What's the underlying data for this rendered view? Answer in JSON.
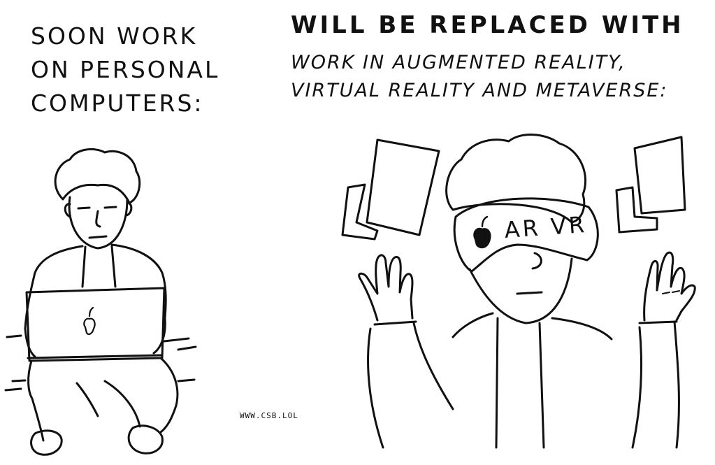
{
  "captions": {
    "left_lines": [
      "SOON WORK",
      "ON PERSONAL",
      "COMPUTERS:"
    ],
    "right_line_1": "WILL BE REPLACED WITH",
    "right_lines_2": [
      "WORK IN AUGMENTED REALITY,",
      "VIRTUAL REALITY AND METAVERSE:"
    ]
  },
  "headset_label": "AR VR",
  "watermark": "WWW.CSB.LOL",
  "icons": {
    "laptop_logo": "apple-logo-icon",
    "headset_logo": "apple-logo-icon"
  },
  "colors": {
    "ink": "#111111",
    "paper": "#ffffff"
  }
}
